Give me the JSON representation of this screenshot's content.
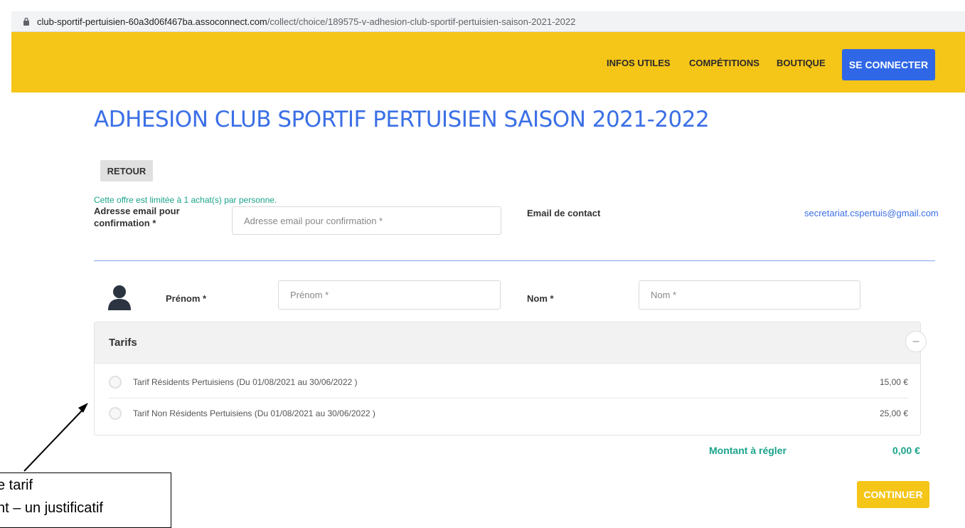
{
  "browser": {
    "url_host": "club-sportif-pertuisien-60a3d06f467ba.assoconnect.com",
    "url_path": "/collect/choice/189575-v-adhesion-club-sportif-pertuisien-saison-2021-2022"
  },
  "nav": {
    "items": [
      "INFOS UTILES",
      "COMPÉTITIONS",
      "BOUTIQUE"
    ],
    "login_label": "SE CONNECTER"
  },
  "page": {
    "title": "ADHESION CLUB SPORTIF PERTUISIEN SAISON 2021-2022",
    "back_label": "RETOUR",
    "limit_note": "Cette offre est limitée à 1 achat(s) par personne."
  },
  "form": {
    "email_label": "Adresse email pour confirmation *",
    "email_placeholder": "Adresse email pour confirmation *",
    "contact_label": "Email de contact",
    "contact_email": "secretariat.cspertuis@gmail.com",
    "firstname_label": "Prénom *",
    "firstname_placeholder": "Prénom *",
    "lastname_label": "Nom *",
    "lastname_placeholder": "Nom *"
  },
  "tarifs": {
    "title": "Tarifs",
    "collapse_symbol": "–",
    "rows": [
      {
        "label": "Tarif Résidents Pertuisiens (Du 01/08/2021 au 30/06/2022 )",
        "price": "15,00 €"
      },
      {
        "label": "Tarif Non Résidents Pertuisiens (Du 01/08/2021 au 30/06/2022 )",
        "price": "25,00 €"
      }
    ]
  },
  "summary": {
    "amount_label": "Montant à régler",
    "amount_value": "0,00 €",
    "continue_label": "CONTINUER"
  },
  "annotation": {
    "line1": "e tarif",
    "line2": "nt – un justificatif"
  },
  "colors": {
    "header_bg": "#f5c518",
    "primary_blue": "#2f67e6",
    "accent_green": "#1aa38a"
  }
}
